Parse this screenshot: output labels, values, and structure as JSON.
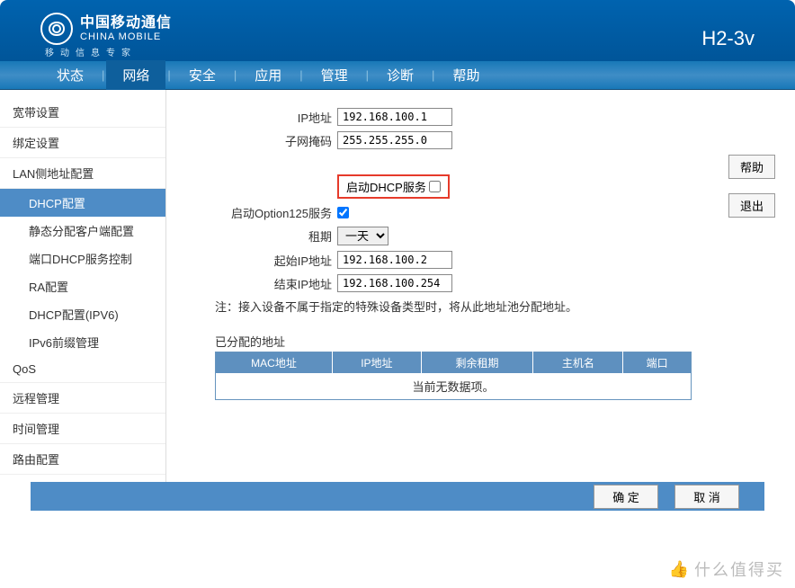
{
  "header": {
    "brand_cn": "中国移动通信",
    "brand_en": "CHINA MOBILE",
    "brand_sub": "移动信息专家",
    "model": "H2-3v"
  },
  "nav": {
    "items": [
      "状态",
      "网络",
      "安全",
      "应用",
      "管理",
      "诊断",
      "帮助"
    ],
    "active_index": 1
  },
  "sidebar": {
    "broadband": "宽带设置",
    "binding": "绑定设置",
    "lan_group": "LAN侧地址配置",
    "lan_subs": [
      "DHCP配置",
      "静态分配客户端配置",
      "端口DHCP服务控制",
      "RA配置",
      "DHCP配置(IPV6)",
      "IPv6前缀管理"
    ],
    "lan_active_index": 0,
    "qos": "QoS",
    "remote": "远程管理",
    "time": "时间管理",
    "route": "路由配置"
  },
  "form": {
    "ip_label": "IP地址",
    "ip_value": "192.168.100.1",
    "mask_label": "子网掩码",
    "mask_value": "255.255.255.0",
    "dhcp_enable_label": "启动DHCP服务",
    "dhcp_enable_checked": false,
    "option125_label": "启动Option125服务",
    "option125_checked": true,
    "lease_label": "租期",
    "lease_value": "一天",
    "start_ip_label": "起始IP地址",
    "start_ip_value": "192.168.100.2",
    "end_ip_label": "结束IP地址",
    "end_ip_value": "192.168.100.254",
    "note": "注：接入设备不属于指定的特殊设备类型时，将从此地址池分配地址。"
  },
  "side_buttons": {
    "help": "帮助",
    "exit": "退出"
  },
  "table": {
    "title": "已分配的地址",
    "headers": [
      "MAC地址",
      "IP地址",
      "剩余租期",
      "主机名",
      "端口"
    ],
    "empty": "当前无数据项。"
  },
  "footer": {
    "ok": "确 定",
    "cancel": "取 消"
  },
  "watermark": "什么值得买"
}
